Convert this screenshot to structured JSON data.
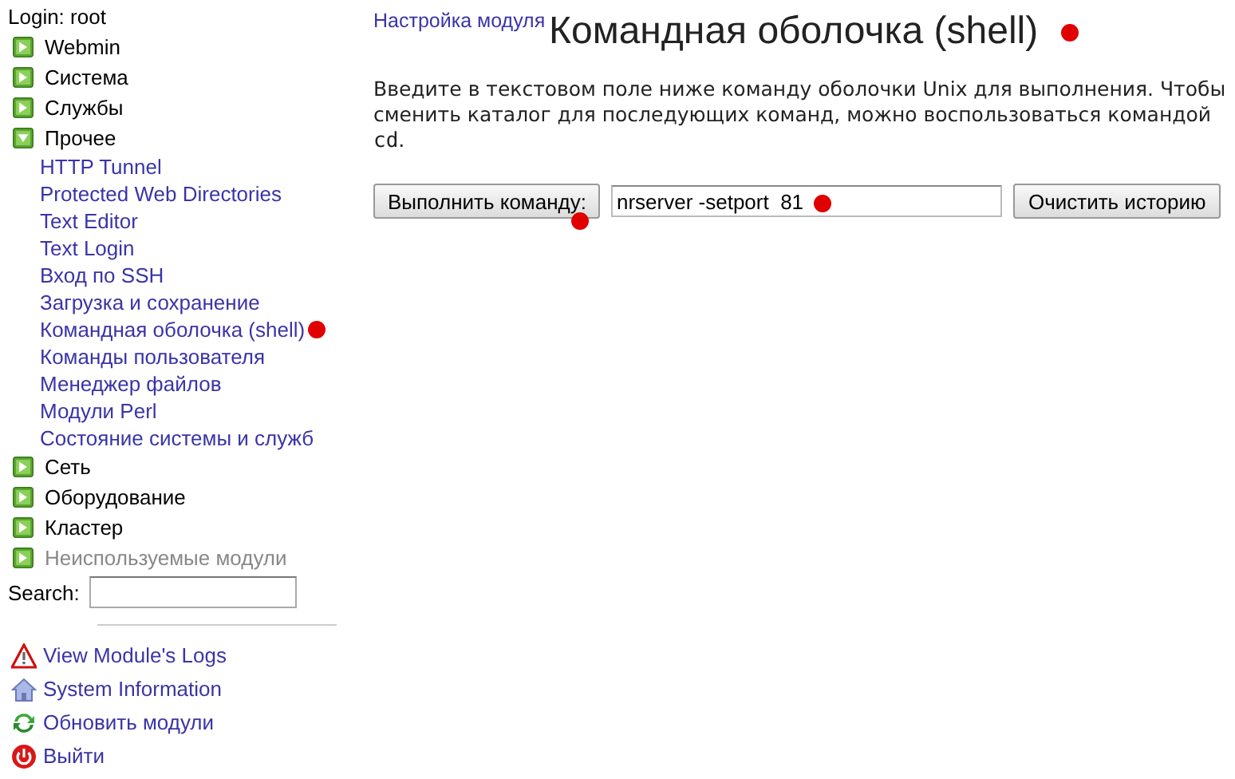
{
  "sidebar": {
    "login": "Login: root",
    "categories": [
      {
        "label": "Webmin",
        "expanded": false,
        "disabled": false
      },
      {
        "label": "Система",
        "expanded": false,
        "disabled": false
      },
      {
        "label": "Службы",
        "expanded": false,
        "disabled": false
      },
      {
        "label": "Прочее",
        "expanded": true,
        "disabled": false,
        "children": [
          {
            "label": "HTTP Tunnel",
            "marked": false
          },
          {
            "label": "Protected Web Directories",
            "marked": false
          },
          {
            "label": "Text Editor",
            "marked": false
          },
          {
            "label": "Text Login",
            "marked": false
          },
          {
            "label": "Вход по SSH",
            "marked": false
          },
          {
            "label": "Загрузка и сохранение",
            "marked": false
          },
          {
            "label": "Командная оболочка (shell)",
            "marked": true
          },
          {
            "label": "Команды пользователя",
            "marked": false
          },
          {
            "label": "Менеджер файлов",
            "marked": false
          },
          {
            "label": "Модули Perl",
            "marked": false
          },
          {
            "label": "Состояние системы и служб",
            "marked": false
          }
        ]
      },
      {
        "label": "Сеть",
        "expanded": false,
        "disabled": false
      },
      {
        "label": "Оборудование",
        "expanded": false,
        "disabled": false
      },
      {
        "label": "Кластер",
        "expanded": false,
        "disabled": false
      },
      {
        "label": "Неиспользуемые модули",
        "expanded": false,
        "disabled": true
      }
    ],
    "search": {
      "label": "Search:"
    },
    "links": [
      {
        "kind": "warning",
        "label": "View Module's Logs"
      },
      {
        "kind": "home",
        "label": "System Information"
      },
      {
        "kind": "refresh",
        "label": "Обновить модули"
      },
      {
        "kind": "power",
        "label": "Выйти"
      }
    ]
  },
  "main": {
    "config_link": "Настройка модуля",
    "title": "Командная оболочка (shell)",
    "title_marked": true,
    "description": {
      "text": "Введите в текстовом поле ниже команду оболочки Unix для выполнения. Чтобы сменить каталог для последующих команд, можно воспользоваться командой ",
      "code": "cd",
      "end": "."
    },
    "run_button": {
      "label": "Выполнить команду:",
      "marked": true
    },
    "command": {
      "value": "nrserver -setport  81",
      "marked": true
    },
    "clear_button": {
      "label": "Очистить историю"
    }
  }
}
